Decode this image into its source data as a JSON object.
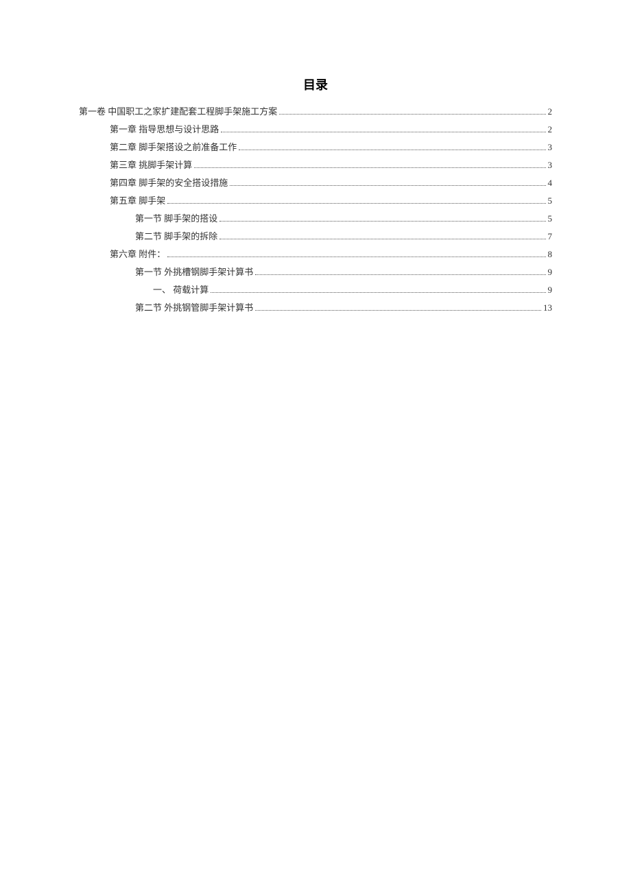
{
  "title": "目录",
  "entries": [
    {
      "indent": 0,
      "text": "第一卷 中国职工之家扩建配套工程脚手架施工方案",
      "page": "2"
    },
    {
      "indent": 1,
      "text": "第一章 指导思想与设计思路 ",
      "page": "2"
    },
    {
      "indent": 1,
      "text": "第二章 脚手架搭设之前准备工作 ",
      "page": "3"
    },
    {
      "indent": 1,
      "text": "第三章 挑脚手架计算 ",
      "page": "3"
    },
    {
      "indent": 1,
      "text": "第四章 脚手架的安全搭设措施 ",
      "page": "4"
    },
    {
      "indent": 1,
      "text": "第五章 脚手架 ",
      "page": "5"
    },
    {
      "indent": 2,
      "text": "第一节 脚手架的搭设",
      "page": "5"
    },
    {
      "indent": 2,
      "text": "第二节 脚手架的拆除",
      "page": "7"
    },
    {
      "indent": 1,
      "text": "第六章 附件： ",
      "page": "8"
    },
    {
      "indent": 2,
      "text": "第一节 外挑槽钢脚手架计算书",
      "page": "9"
    },
    {
      "indent": 3,
      "text": "一、 荷载计算 ",
      "page": "9"
    },
    {
      "indent": 2,
      "text": "第二节 外挑钢管脚手架计算书",
      "page": "13"
    }
  ]
}
